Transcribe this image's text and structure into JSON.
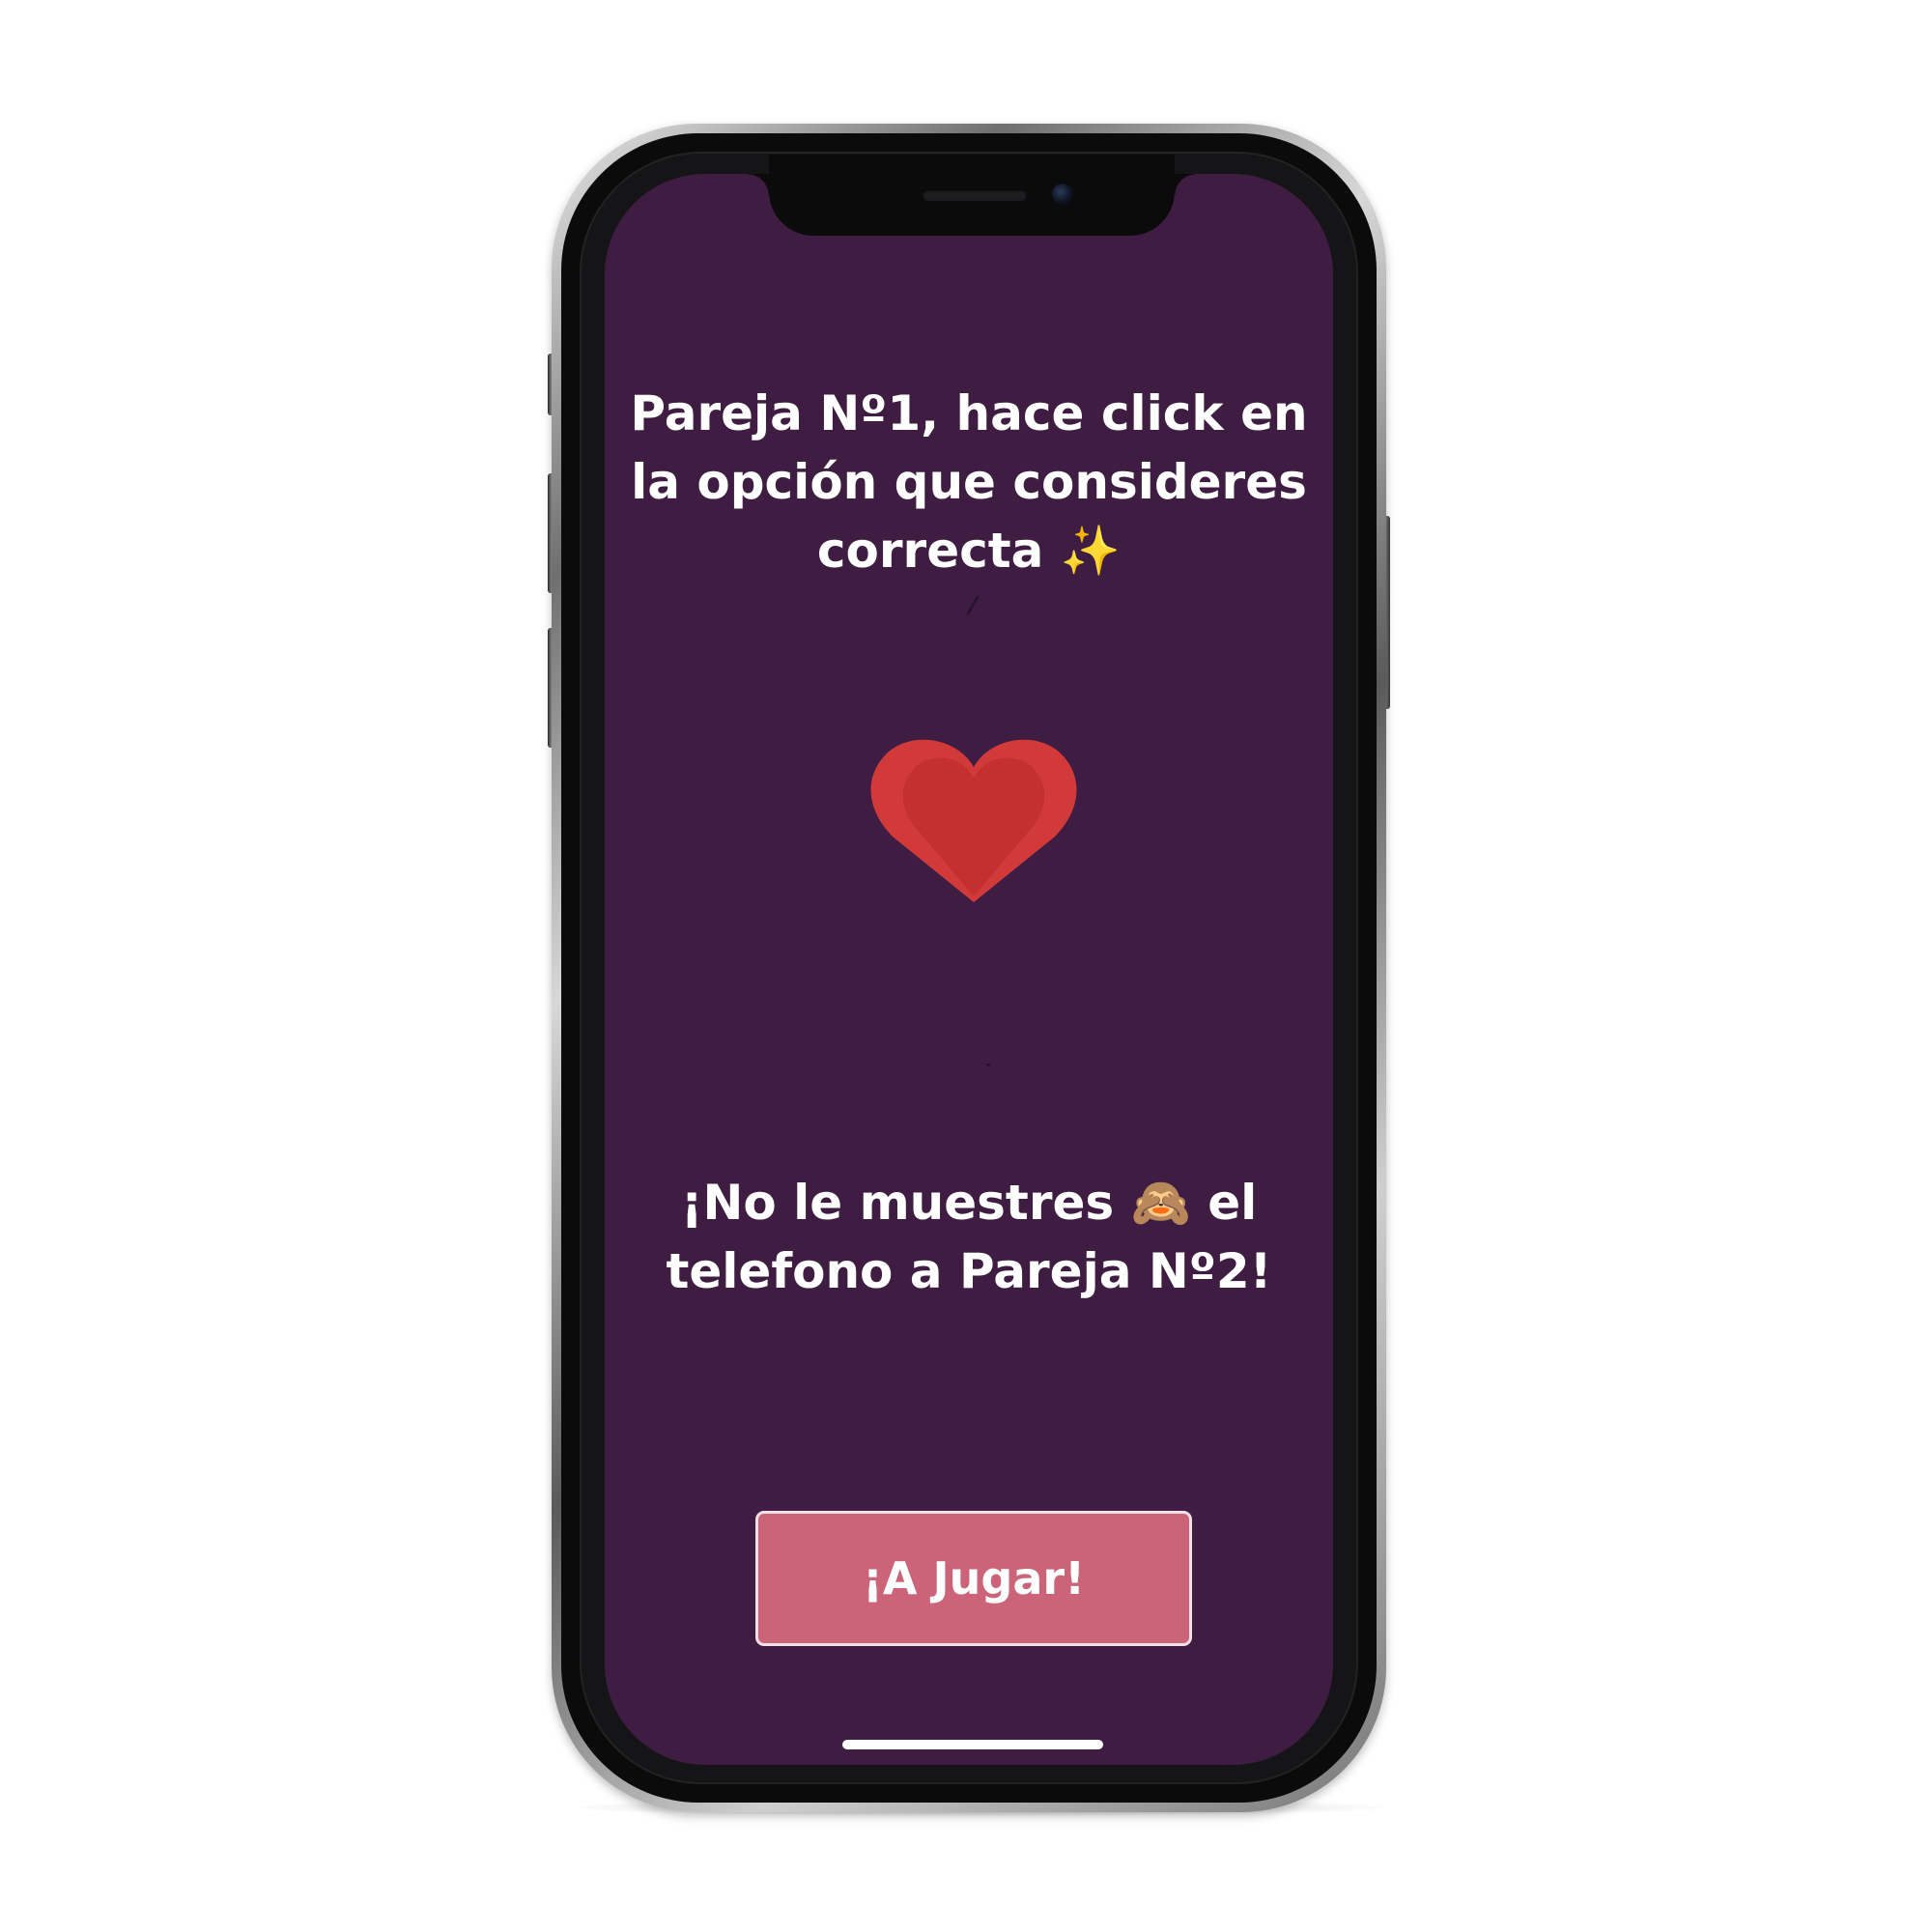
{
  "screen": {
    "instruction": "Pareja Nº1, hace click en la opción que consideres correcta ✨",
    "warning": "¡No le muestres 🙈 el telefono a Pareja Nº2!",
    "play_button_label": "¡A Jugar!",
    "faint_marks": [
      "/",
      "-"
    ]
  },
  "icons": {
    "heart": "heart-icon",
    "sparkles": "sparkles-icon",
    "see_no_evil_monkey": "see-no-evil-monkey-icon"
  },
  "colors": {
    "screen_background": "#3f1d42",
    "button_background": "#cc6479",
    "button_border": "#f3dfe4",
    "heart_dark": "#d23a3a",
    "heart_light": "#c42f30",
    "text": "#ffffff"
  }
}
